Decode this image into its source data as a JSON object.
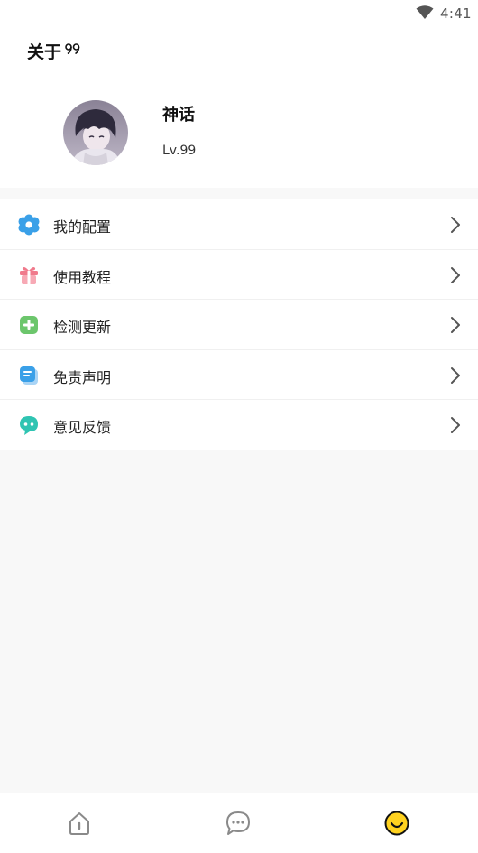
{
  "status_bar": {
    "time": "4:41"
  },
  "header": {
    "title": "关于"
  },
  "profile": {
    "name": "神话",
    "level": "Lv.99"
  },
  "menu": {
    "items": [
      {
        "label": "我的配置",
        "icon": "flower-gear-icon",
        "color": "#3aa0e8"
      },
      {
        "label": "使用教程",
        "icon": "gift-icon",
        "color": "#f07a8c"
      },
      {
        "label": "检测更新",
        "icon": "plus-square-icon",
        "color": "#6cc66c"
      },
      {
        "label": "免责声明",
        "icon": "document-icon",
        "color": "#3aa0e8"
      },
      {
        "label": "意见反馈",
        "icon": "chat-bubble-icon",
        "color": "#2fc4b2"
      }
    ]
  },
  "tabbar": {
    "tabs": [
      {
        "icon": "home-icon",
        "active": false
      },
      {
        "icon": "message-icon",
        "active": false
      },
      {
        "icon": "smile-icon",
        "active": true,
        "color": "#ffd21f"
      }
    ]
  }
}
